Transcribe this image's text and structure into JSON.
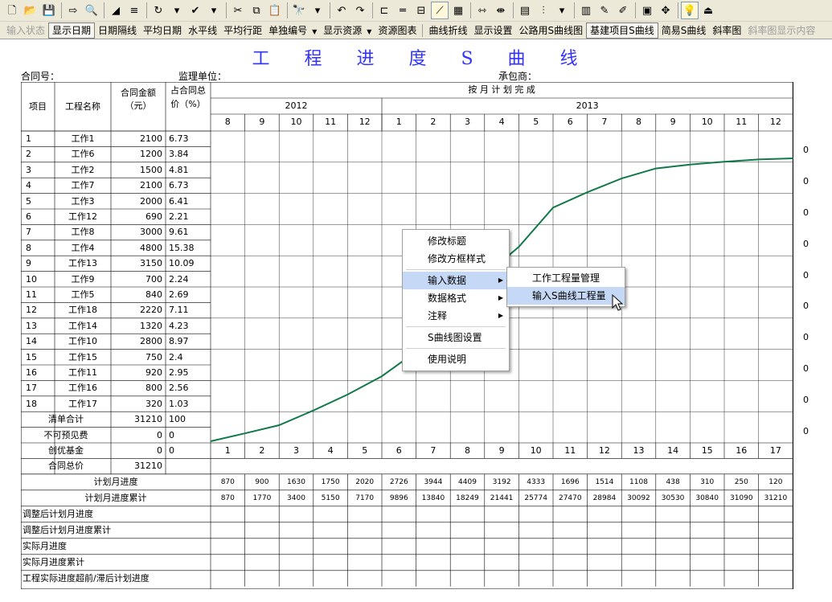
{
  "toolbar": {
    "row1_icons": [
      {
        "name": "new-file-icon",
        "glyph": "🗋"
      },
      {
        "name": "open-folder-icon",
        "glyph": "📂"
      },
      {
        "name": "save-icon",
        "glyph": "💾"
      },
      {
        "sep": true
      },
      {
        "name": "export-icon",
        "glyph": "⇨"
      },
      {
        "name": "print-preview-icon",
        "glyph": "🔍"
      },
      {
        "sep": true
      },
      {
        "name": "draw-line-icon",
        "glyph": "◢"
      },
      {
        "name": "text-style-icon",
        "glyph": "≡"
      },
      {
        "sep": true
      },
      {
        "name": "refresh-icon",
        "glyph": "↻"
      },
      {
        "name": "dropdown-arrow-icon",
        "glyph": "▾"
      },
      {
        "name": "check-tool-icon",
        "glyph": "✔"
      },
      {
        "name": "dropdown-arrow-icon",
        "glyph": "▾"
      },
      {
        "sep": true
      },
      {
        "name": "cut-icon",
        "glyph": "✂"
      },
      {
        "name": "copy-icon",
        "glyph": "⧉"
      },
      {
        "name": "paste-icon",
        "glyph": "📋"
      },
      {
        "sep": true
      },
      {
        "name": "find-icon",
        "glyph": "🔭"
      },
      {
        "name": "dropdown-arrow-icon",
        "glyph": "▾"
      },
      {
        "sep": true
      },
      {
        "name": "undo-icon",
        "glyph": "↶"
      },
      {
        "name": "redo-icon",
        "glyph": "↷"
      },
      {
        "sep": true
      },
      {
        "name": "gantt-icon",
        "glyph": "⊏"
      },
      {
        "name": "bar-icon",
        "glyph": "═"
      },
      {
        "name": "schedule-icon",
        "glyph": "⊟"
      },
      {
        "name": "s-curve-icon",
        "glyph": "⟋",
        "active": true
      },
      {
        "name": "resource-icon",
        "glyph": "▦"
      },
      {
        "sep": true
      },
      {
        "name": "link-icon",
        "glyph": "⇿"
      },
      {
        "name": "link-alt-icon",
        "glyph": "⇼"
      },
      {
        "sep": true
      },
      {
        "name": "calendar-icon",
        "glyph": "▤"
      },
      {
        "name": "indent-icon",
        "glyph": "⫶"
      },
      {
        "name": "dropdown-arrow-icon",
        "glyph": "▾"
      },
      {
        "sep": true
      },
      {
        "name": "books-icon",
        "glyph": "▥"
      },
      {
        "name": "chart-tool-icon",
        "glyph": "✎"
      },
      {
        "name": "edit-chart-icon",
        "glyph": "✐"
      },
      {
        "sep": true
      },
      {
        "name": "monitor-icon",
        "glyph": "▣"
      },
      {
        "name": "move-icon",
        "glyph": "✥"
      },
      {
        "sep": true
      },
      {
        "name": "tip-bulb-icon",
        "glyph": "💡",
        "active": true
      },
      {
        "name": "exit-icon",
        "glyph": "⏏"
      }
    ],
    "row2_items": [
      {
        "name": "input-status-button",
        "label": "输入状态",
        "disabled": true
      },
      {
        "name": "show-date-button",
        "label": "显示日期",
        "pressed": true
      },
      {
        "name": "date-interval-button",
        "label": "日期隔线"
      },
      {
        "name": "average-date-button",
        "label": "平均日期"
      },
      {
        "name": "horizontal-line-button",
        "label": "水平线"
      },
      {
        "name": "average-row-spacing-button",
        "label": "平均行距"
      },
      {
        "name": "separate-numbering-button",
        "label": "单独编号",
        "dropdown": true
      },
      {
        "name": "show-resources-button",
        "label": "显示资源",
        "dropdown": true
      },
      {
        "name": "resource-chart-button",
        "label": "资源图表"
      },
      {
        "sep": true
      },
      {
        "name": "curve-polyline-button",
        "label": "曲线折线"
      },
      {
        "name": "display-settings-button",
        "label": "显示设置"
      },
      {
        "name": "highway-s-curve-button",
        "label": "公路用S曲线图"
      },
      {
        "name": "construction-s-curve-button",
        "label": "基建项目S曲线",
        "pressed": true
      },
      {
        "name": "simple-s-curve-button",
        "label": "简易S曲线"
      },
      {
        "name": "slope-chart-button",
        "label": "斜率图"
      },
      {
        "name": "slope-display-content-button",
        "label": "斜率图显示内容",
        "disabled": true
      }
    ]
  },
  "page": {
    "title": "工 程 进 度 S 曲 线",
    "contract_no_label": "合同号：",
    "supervisor_label": "监理单位：",
    "contractor_label": "承包商："
  },
  "table": {
    "headers": {
      "item": "项目",
      "name": "工程名称",
      "amount": "合同金额（元）",
      "ratio": "占合同总价（%）",
      "monthly_plan": "按 月 计 划 完 成"
    },
    "years": [
      {
        "label": "2012",
        "months": 5
      },
      {
        "label": "2013",
        "months": 12
      }
    ],
    "months": [
      "8",
      "9",
      "10",
      "11",
      "12",
      "1",
      "2",
      "3",
      "4",
      "5",
      "6",
      "7",
      "8",
      "9",
      "10",
      "11",
      "12"
    ],
    "rows": [
      {
        "no": "1",
        "name": "工作1",
        "amount": "2100",
        "ratio": "6.73"
      },
      {
        "no": "2",
        "name": "工作6",
        "amount": "1200",
        "ratio": "3.84"
      },
      {
        "no": "3",
        "name": "工作2",
        "amount": "1500",
        "ratio": "4.81"
      },
      {
        "no": "4",
        "name": "工作7",
        "amount": "2100",
        "ratio": "6.73"
      },
      {
        "no": "5",
        "name": "工作3",
        "amount": "2000",
        "ratio": "6.41"
      },
      {
        "no": "6",
        "name": "工作12",
        "amount": "690",
        "ratio": "2.21"
      },
      {
        "no": "7",
        "name": "工作8",
        "amount": "3000",
        "ratio": "9.61"
      },
      {
        "no": "8",
        "name": "工作4",
        "amount": "4800",
        "ratio": "15.38"
      },
      {
        "no": "9",
        "name": "工作13",
        "amount": "3150",
        "ratio": "10.09"
      },
      {
        "no": "10",
        "name": "工作9",
        "amount": "700",
        "ratio": "2.24"
      },
      {
        "no": "11",
        "name": "工作5",
        "amount": "840",
        "ratio": "2.69"
      },
      {
        "no": "12",
        "name": "工作18",
        "amount": "2220",
        "ratio": "7.11"
      },
      {
        "no": "13",
        "name": "工作14",
        "amount": "1320",
        "ratio": "4.23"
      },
      {
        "no": "14",
        "name": "工作10",
        "amount": "2800",
        "ratio": "8.97"
      },
      {
        "no": "15",
        "name": "工作15",
        "amount": "750",
        "ratio": "2.4"
      },
      {
        "no": "16",
        "name": "工作11",
        "amount": "920",
        "ratio": "2.95"
      },
      {
        "no": "17",
        "name": "工作16",
        "amount": "800",
        "ratio": "2.56"
      },
      {
        "no": "18",
        "name": "工作17",
        "amount": "320",
        "ratio": "1.03"
      }
    ],
    "summary": [
      {
        "label": "清单合计",
        "amount": "31210",
        "ratio": "100"
      },
      {
        "label": "不可预见费",
        "amount": "0",
        "ratio": "0"
      },
      {
        "label": "创优基金",
        "amount": "0",
        "ratio": "0"
      },
      {
        "label": "合同总价",
        "amount": "31210",
        "ratio": ""
      }
    ],
    "period_numbers": [
      "1",
      "2",
      "3",
      "4",
      "5",
      "6",
      "7",
      "8",
      "9",
      "10",
      "11",
      "12",
      "13",
      "14",
      "15",
      "16",
      "17"
    ],
    "bottom_rows": [
      {
        "label": "计划月进度",
        "values": [
          "870",
          "900",
          "1630",
          "1750",
          "2020",
          "2726",
          "3944",
          "4409",
          "3192",
          "4333",
          "1696",
          "1514",
          "1108",
          "438",
          "310",
          "250",
          "120"
        ]
      },
      {
        "label": "计划月进度累计",
        "values": [
          "870",
          "1770",
          "3400",
          "5150",
          "7170",
          "9896",
          "13840",
          "18249",
          "21441",
          "25774",
          "27470",
          "28984",
          "30092",
          "30530",
          "30840",
          "31090",
          "31210"
        ]
      },
      {
        "label": "调整后计划月进度",
        "values": []
      },
      {
        "label": "调整后计划月进度累计",
        "values": []
      },
      {
        "label": "实际月进度",
        "values": []
      },
      {
        "label": "实际月进度累计",
        "values": []
      },
      {
        "label": "工程实际进度超前/滞后计划进度",
        "values": []
      }
    ],
    "right_axis_values": [
      "0",
      "0",
      "0",
      "0",
      "0",
      "0",
      "0",
      "0",
      "0",
      "0"
    ]
  },
  "chart_data": {
    "type": "line",
    "categories": [
      "8",
      "9",
      "10",
      "11",
      "12",
      "1",
      "2",
      "3",
      "4",
      "5",
      "6",
      "7",
      "8",
      "9",
      "10",
      "11",
      "12"
    ],
    "series": [
      {
        "values": [
          870,
          1770,
          3400,
          5150,
          7170,
          9896,
          13840,
          18249,
          21441,
          25774,
          27470,
          28984,
          30092,
          30530,
          30840,
          31090,
          31210
        ]
      }
    ],
    "ylim": [
      0,
      31210
    ],
    "color": "#127a4a"
  },
  "context_menu": {
    "items": [
      {
        "name": "menu-edit-title",
        "label": "修改标题"
      },
      {
        "name": "menu-edit-frame-style",
        "label": "修改方框样式"
      },
      {
        "sep": true
      },
      {
        "name": "menu-input-data",
        "label": "输入数据",
        "submenu": true,
        "highlight": true
      },
      {
        "name": "menu-data-format",
        "label": "数据格式",
        "submenu": true
      },
      {
        "name": "menu-annotation",
        "label": "注释",
        "submenu": true
      },
      {
        "sep": true
      },
      {
        "name": "menu-s-curve-settings",
        "label": "S曲线图设置"
      },
      {
        "sep": true
      },
      {
        "name": "menu-instructions",
        "label": "使用说明"
      }
    ],
    "submenu": [
      {
        "name": "submenu-work-quantity-management",
        "label": "工作工程量管理"
      },
      {
        "name": "submenu-input-s-curve-quantity",
        "label": "输入S曲线工程量",
        "highlight": true
      }
    ]
  }
}
